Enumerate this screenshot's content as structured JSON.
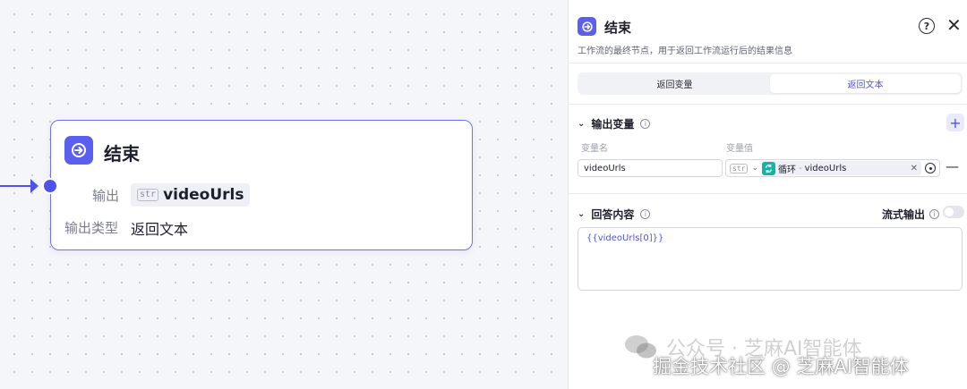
{
  "node": {
    "title": "结束",
    "output_label": "输出",
    "output_var_type": "str",
    "output_var": "videoUrls",
    "output_type_label": "输出类型",
    "output_type_value": "返回文本"
  },
  "panel": {
    "title": "结束",
    "description": "工作流的最终节点，用于返回工作流运行后的结果信息",
    "tabs": [
      {
        "label": "返回变量",
        "active": false
      },
      {
        "label": "返回文本",
        "active": true
      }
    ],
    "output_section": {
      "title": "输出变量",
      "col_name_label": "变量名",
      "col_value_label": "变量值",
      "var_name": "videoUrls",
      "value_type": "str",
      "ref_source": "循环",
      "ref_var": "videoUrls"
    },
    "answer_section": {
      "title": "回答内容",
      "stream_label": "流式输出",
      "stream_enabled": false,
      "content": "{{videoUrls[0]}}"
    }
  },
  "watermark": {
    "line1": "公众号 · 芝麻AI智能体",
    "line2": "掘金技术社区 @ 芝麻AI智能体"
  },
  "colors": {
    "accent": "#4d53e8",
    "loop_icon": "#11b5a4"
  }
}
